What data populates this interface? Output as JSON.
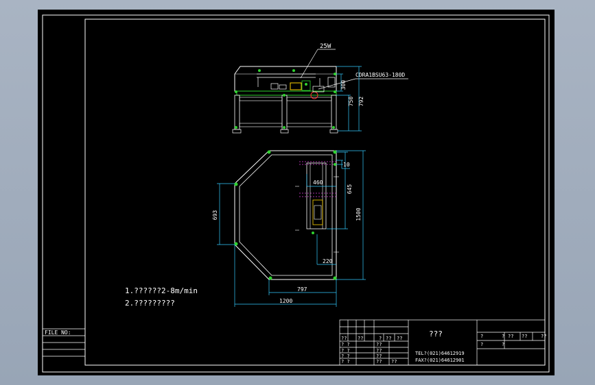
{
  "notes": {
    "line1": "1.??????2-8m/min",
    "line2": "2.?????????"
  },
  "file_label": "FILE  NO:",
  "side_view": {
    "motor_label": "25W",
    "cylinder_label": "CDRA1BSU63-180D",
    "dim_300": "300",
    "dim_750": "750",
    "dim_792": "792"
  },
  "plan_view": {
    "dim_10": "10",
    "dim_460": "460",
    "dim_645": "645",
    "dim_693": "693",
    "dim_1500": "1500",
    "dim_220": "220",
    "dim_797": "797",
    "dim_1200": "1200"
  },
  "title_block": {
    "title": "???",
    "tel": "TEL?(021)64612919",
    "fax": "FAX?(021)64612901",
    "row_a": [
      "??",
      "??",
      "?",
      "??",
      "??"
    ],
    "left_col": [
      "? ?",
      "? ?",
      "? ?",
      "? ?"
    ],
    "mid_col": [
      "??",
      "??",
      "??",
      "??",
      "??"
    ],
    "right_row": [
      "?",
      "?",
      "??",
      "??",
      "??"
    ],
    "right_row2": [
      "?",
      "?"
    ]
  }
}
